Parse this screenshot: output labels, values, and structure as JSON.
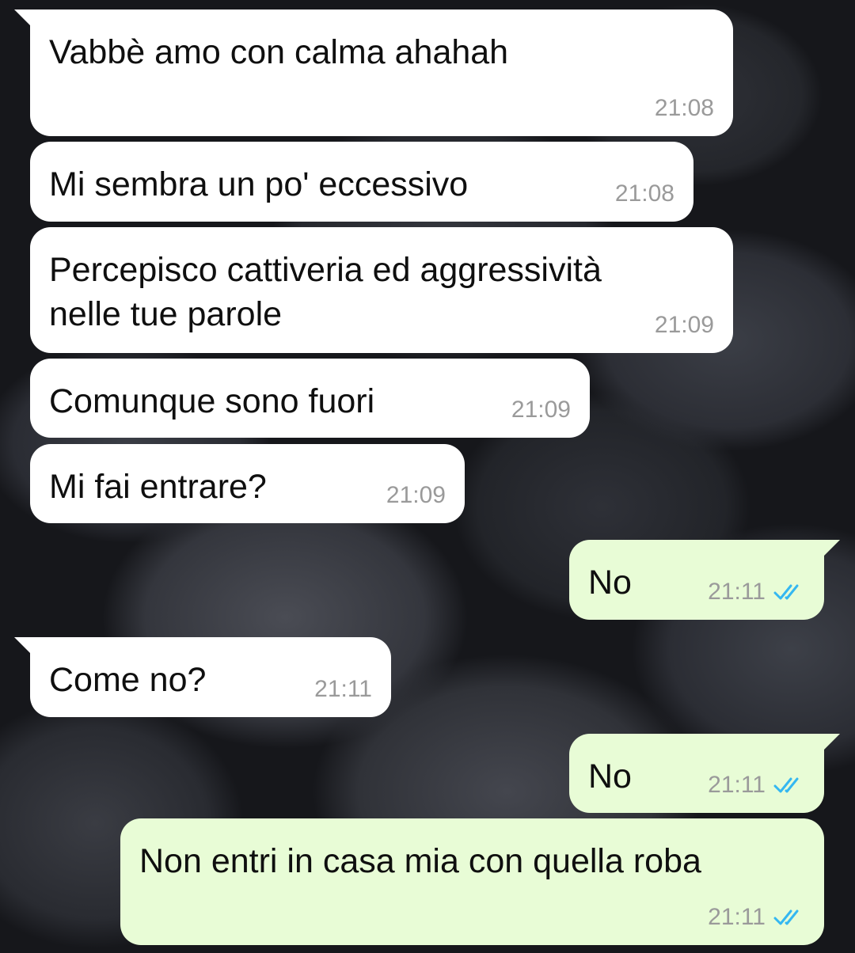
{
  "messages": [
    {
      "text": "Vabbè amo con calma ahahah",
      "time": "21:08"
    },
    {
      "text": "Mi sembra un po' eccessivo",
      "time": "21:08"
    },
    {
      "lines": [
        "Percepisco cattiveria ed aggressività",
        "nelle tue parole"
      ],
      "time": "21:09"
    },
    {
      "text": "Comunque sono fuori",
      "time": "21:09"
    },
    {
      "text": "Mi fai entrare?",
      "time": "21:09"
    },
    {
      "text": "No",
      "time": "21:11"
    },
    {
      "text": "Come no?",
      "time": "21:11"
    },
    {
      "text": "No",
      "time": "21:11"
    },
    {
      "text": "Non entri in casa mia con quella roba",
      "time": "21:11"
    }
  ],
  "colors": {
    "incoming_bubble": "#ffffff",
    "outgoing_bubble": "#e8fcd6",
    "read_ticks": "#34b7f1",
    "timestamp": "#9a9a9a"
  },
  "icons": {
    "read_status": "double-check-icon"
  }
}
